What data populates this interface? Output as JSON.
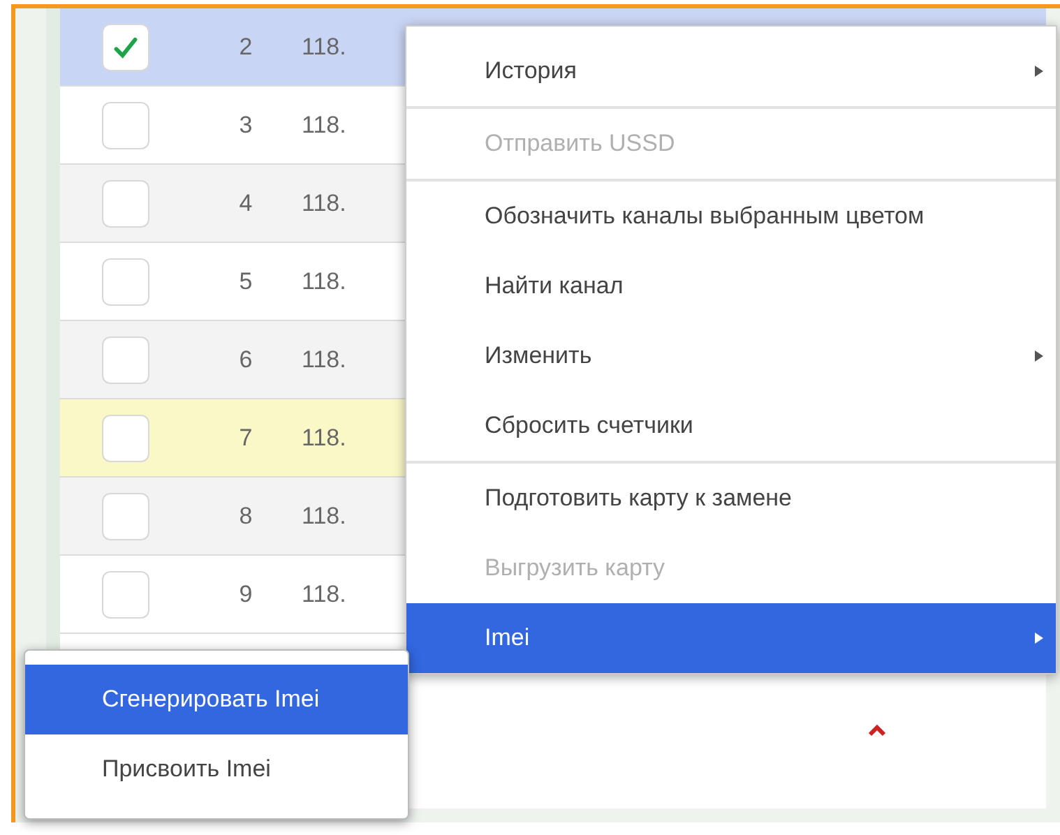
{
  "table": {
    "rows": [
      {
        "number": "2",
        "address": "118.",
        "checked": true,
        "selected": true,
        "marked": false
      },
      {
        "number": "3",
        "address": "118.",
        "checked": false,
        "selected": false,
        "marked": false
      },
      {
        "number": "4",
        "address": "118.",
        "checked": false,
        "selected": false,
        "marked": false
      },
      {
        "number": "5",
        "address": "118.",
        "checked": false,
        "selected": false,
        "marked": false
      },
      {
        "number": "6",
        "address": "118.",
        "checked": false,
        "selected": false,
        "marked": false
      },
      {
        "number": "7",
        "address": "118.",
        "checked": false,
        "selected": false,
        "marked": true
      },
      {
        "number": "8",
        "address": "118.",
        "checked": false,
        "selected": false,
        "marked": false
      },
      {
        "number": "9",
        "address": "118.",
        "checked": false,
        "selected": false,
        "marked": false
      }
    ]
  },
  "context_menu": {
    "groups": [
      [
        {
          "label": "История",
          "disabled": false,
          "submenu": true,
          "selected": false
        }
      ],
      [
        {
          "label": "Отправить USSD",
          "disabled": true,
          "submenu": false,
          "selected": false
        }
      ],
      [
        {
          "label": "Обозначить каналы выбранным цветом",
          "disabled": false,
          "submenu": false,
          "selected": false
        },
        {
          "label": "Найти канал",
          "disabled": false,
          "submenu": false,
          "selected": false
        },
        {
          "label": "Изменить",
          "disabled": false,
          "submenu": true,
          "selected": false
        },
        {
          "label": "Сбросить счетчики",
          "disabled": false,
          "submenu": false,
          "selected": false
        }
      ],
      [
        {
          "label": "Подготовить карту к замене",
          "disabled": false,
          "submenu": false,
          "selected": false
        },
        {
          "label": "Выгрузить карту",
          "disabled": true,
          "submenu": false,
          "selected": false
        },
        {
          "label": "Imei",
          "disabled": false,
          "submenu": true,
          "selected": true
        }
      ]
    ]
  },
  "submenu": {
    "items": [
      {
        "label": "Сгенерировать Imei",
        "selected": true
      },
      {
        "label": "Присвоить Imei",
        "selected": false
      }
    ]
  }
}
